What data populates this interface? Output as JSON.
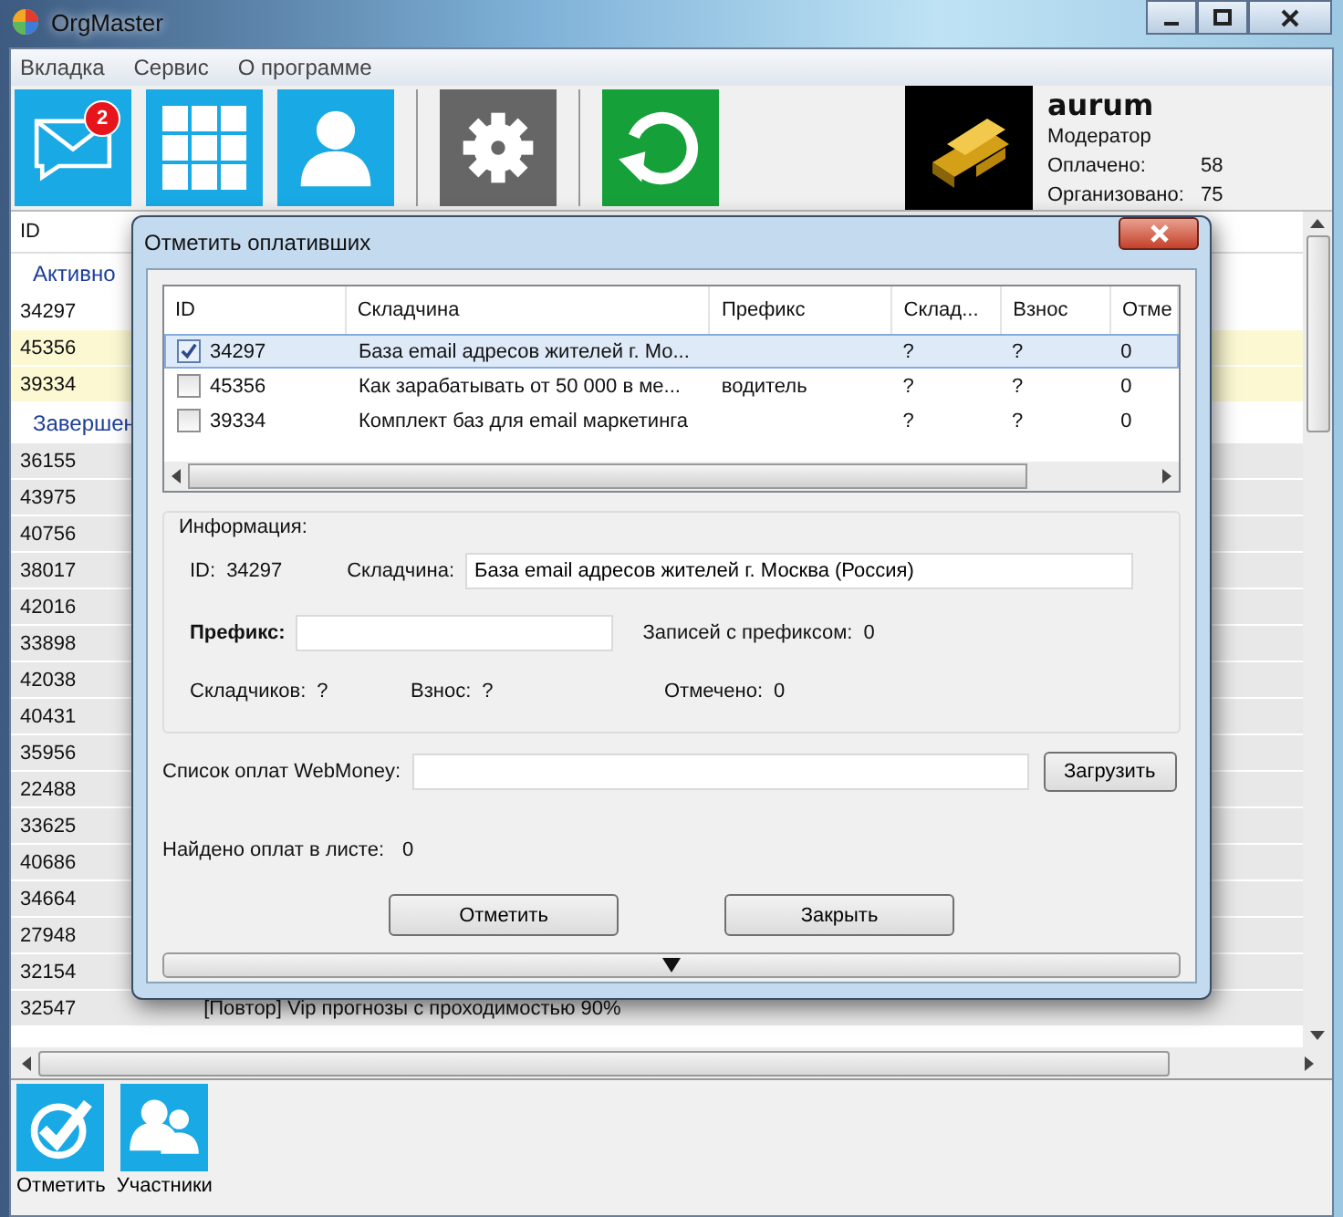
{
  "window": {
    "title": "OrgMaster"
  },
  "menu": [
    {
      "label": "Вкладка"
    },
    {
      "label": "Сервис"
    },
    {
      "label": "О программе"
    }
  ],
  "toolbar": [
    {
      "kind": "mail",
      "badge": "2"
    },
    {
      "kind": "grid"
    },
    {
      "kind": "person"
    },
    {
      "kind": "settings"
    },
    {
      "kind": "refresh"
    }
  ],
  "user": {
    "name": "aurum",
    "role": "Модератор",
    "stats": [
      {
        "label": "Оплачено:",
        "value": "58"
      },
      {
        "label": "Организовано:",
        "value": "75"
      }
    ]
  },
  "list": {
    "header": "ID",
    "groups": [
      {
        "label": "Активно",
        "rows": [
          {
            "id": "34297",
            "highlighted": false
          },
          {
            "id": "45356",
            "highlighted": true
          },
          {
            "id": "39334",
            "highlighted": true
          }
        ]
      },
      {
        "label": "Завершен",
        "rows": [
          {
            "id": "36155",
            "highlighted": false
          },
          {
            "id": "43975",
            "highlighted": false
          },
          {
            "id": "40756",
            "highlighted": false
          },
          {
            "id": "38017",
            "highlighted": false
          },
          {
            "id": "42016",
            "highlighted": false
          },
          {
            "id": "33898",
            "highlighted": false
          },
          {
            "id": "42038",
            "highlighted": false
          },
          {
            "id": "40431",
            "highlighted": false
          },
          {
            "id": "35956",
            "highlighted": false
          },
          {
            "id": "22488",
            "highlighted": false
          },
          {
            "id": "33625",
            "highlighted": false
          },
          {
            "id": "40686",
            "highlighted": false
          },
          {
            "id": "34664",
            "highlighted": false
          },
          {
            "id": "27948",
            "highlighted": false
          },
          {
            "id": "32154",
            "highlighted": false
          },
          {
            "id": "32547",
            "title": "[Повтор] Vip прогнозы с проходимостью 90%",
            "highlighted": false
          }
        ]
      }
    ]
  },
  "bottom_buttons": [
    {
      "kind": "check",
      "label": "Отметить"
    },
    {
      "kind": "people",
      "label": "Участники"
    }
  ],
  "dialog": {
    "title": "Отметить оплативших",
    "columns": [
      "ID",
      "Складчина",
      "Префикс",
      "Склад...",
      "Взнос",
      "Отме"
    ],
    "rows": [
      {
        "checked": true,
        "selected": true,
        "cells": [
          "34297",
          "База email адресов жителей г. Мо...",
          "",
          "?",
          "?",
          "0"
        ]
      },
      {
        "checked": false,
        "selected": false,
        "cells": [
          "45356",
          "Как зарабатывать от 50 000 в ме...",
          "водитель",
          "?",
          "?",
          "0"
        ]
      },
      {
        "checked": false,
        "selected": false,
        "cells": [
          "39334",
          "Комплект баз для email маркетинга",
          "",
          "?",
          "?",
          "0"
        ]
      }
    ],
    "info": {
      "legend": "Информация:",
      "id": {
        "label": "ID:",
        "value": "34297"
      },
      "name": {
        "label": "Складчина:",
        "value": "База email адресов жителей г. Москва (Россия)"
      },
      "prefix": {
        "label": "Префикс:"
      },
      "prefix_count": {
        "label": "Записей с префиксом:",
        "value": "0"
      },
      "members": {
        "label": "Складчиков:",
        "value": "?"
      },
      "fee": {
        "label": "Взнос:",
        "value": "?"
      },
      "marked": {
        "label": "Отмечено:",
        "value": "0"
      }
    },
    "webmoney": {
      "label": "Список оплат WebMoney:",
      "button": "Загрузить"
    },
    "found": {
      "label": "Найдено оплат в листе:",
      "value": "0"
    },
    "buttons": [
      "Отметить",
      "Закрыть"
    ]
  }
}
